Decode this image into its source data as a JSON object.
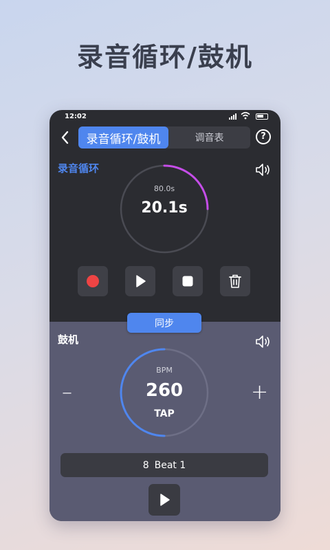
{
  "headline": "录音循环/鼓机",
  "status_bar": {
    "time": "12:02"
  },
  "tabs": [
    {
      "label": "录音循环/鼓机",
      "active": true
    },
    {
      "label": "调音表",
      "active": false
    }
  ],
  "help_label": "?",
  "loop": {
    "title": "录音循环",
    "total_time": "80.0s",
    "current_time": "20.1s",
    "progress": 0.25,
    "ring_color": "#c54de8",
    "controls": [
      "record-icon",
      "play-icon",
      "stop-icon",
      "trash-icon"
    ]
  },
  "sync_label": "同步",
  "drum": {
    "title": "鼓机",
    "bpm_label": "BPM",
    "bpm_value": "260",
    "tap_label": "TAP",
    "minus_label": "–",
    "plus_label": "+",
    "beat_count": "8",
    "beat_label": "Beat 1",
    "progress": 0.5,
    "ring_color": "#4f86ee"
  },
  "colors": {
    "accent": "#4f86ee",
    "record_red": "#ee4444",
    "panel_dark": "#2b2c31",
    "panel_drum": "#5a5b72"
  }
}
